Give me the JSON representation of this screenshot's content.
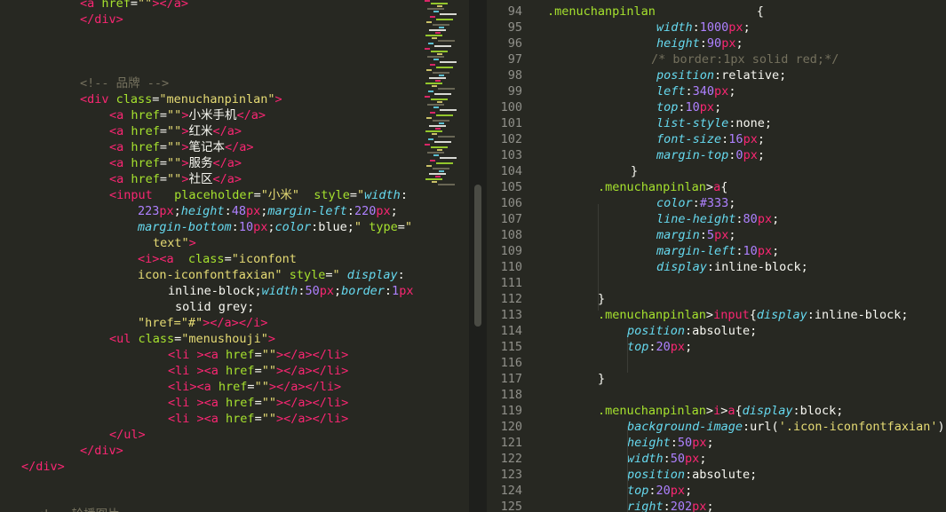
{
  "left_editor": {
    "lines": [
      [
        [
          "tag",
          "<a "
        ],
        [
          "attr",
          "href"
        ],
        [
          "plain",
          "="
        ],
        [
          "str",
          "\"\""
        ],
        [
          "tag",
          ">"
        ],
        [
          "tag",
          "</a>"
        ]
      ],
      [
        [
          "tag",
          "</div>"
        ]
      ],
      [],
      [],
      [],
      [
        [
          "cmt",
          "<!-- 品牌 -->"
        ]
      ],
      [
        [
          "tag",
          "<div "
        ],
        [
          "attr",
          "class"
        ],
        [
          "plain",
          "="
        ],
        [
          "str",
          "\"menuchanpinlan\""
        ],
        [
          "tag",
          ">"
        ]
      ],
      [
        [
          "tag",
          "<a "
        ],
        [
          "attr",
          "href"
        ],
        [
          "plain",
          "="
        ],
        [
          "str",
          "\"\""
        ],
        [
          "tag",
          ">"
        ],
        [
          "plain",
          "小米手机"
        ],
        [
          "tag",
          "</a>"
        ]
      ],
      [
        [
          "tag",
          "<a "
        ],
        [
          "attr",
          "href"
        ],
        [
          "plain",
          "="
        ],
        [
          "str",
          "\"\""
        ],
        [
          "tag",
          ">"
        ],
        [
          "plain",
          "红米"
        ],
        [
          "tag",
          "</a>"
        ]
      ],
      [
        [
          "tag",
          "<a "
        ],
        [
          "attr",
          "href"
        ],
        [
          "plain",
          "="
        ],
        [
          "str",
          "\"\""
        ],
        [
          "tag",
          ">"
        ],
        [
          "plain",
          "笔记本"
        ],
        [
          "tag",
          "</a>"
        ]
      ],
      [
        [
          "tag",
          "<a "
        ],
        [
          "attr",
          "href"
        ],
        [
          "plain",
          "="
        ],
        [
          "str",
          "\"\""
        ],
        [
          "tag",
          ">"
        ],
        [
          "plain",
          "服务"
        ],
        [
          "tag",
          "</a>"
        ]
      ],
      [
        [
          "tag",
          "<a "
        ],
        [
          "attr",
          "href"
        ],
        [
          "plain",
          "="
        ],
        [
          "str",
          "\"\""
        ],
        [
          "tag",
          ">"
        ],
        [
          "plain",
          "社区"
        ],
        [
          "tag",
          "</a>"
        ]
      ],
      [
        [
          "tag",
          "<input"
        ],
        [
          "plain",
          "   "
        ],
        [
          "attr",
          "placeholder"
        ],
        [
          "plain",
          "="
        ],
        [
          "str",
          "\"小米\""
        ],
        [
          "plain",
          "  "
        ],
        [
          "attr",
          "style"
        ],
        [
          "plain",
          "="
        ],
        [
          "str",
          "\""
        ],
        [
          "prop",
          "width"
        ],
        [
          "plain",
          ":"
        ]
      ],
      [
        [
          "num",
          "223"
        ],
        [
          "unit",
          "px"
        ],
        [
          "plain",
          ";"
        ],
        [
          "prop",
          "height"
        ],
        [
          "plain",
          ":"
        ],
        [
          "num",
          "48"
        ],
        [
          "unit",
          "px"
        ],
        [
          "plain",
          ";"
        ],
        [
          "prop",
          "margin-left"
        ],
        [
          "plain",
          ":"
        ],
        [
          "num",
          "220"
        ],
        [
          "unit",
          "px"
        ],
        [
          "plain",
          ";"
        ]
      ],
      [
        [
          "prop",
          "margin-bottom"
        ],
        [
          "plain",
          ":"
        ],
        [
          "num",
          "10"
        ],
        [
          "unit",
          "px"
        ],
        [
          "plain",
          ";"
        ],
        [
          "prop",
          "color"
        ],
        [
          "plain",
          ":blue;"
        ],
        [
          "str",
          "\""
        ],
        [
          "plain",
          " "
        ],
        [
          "attr",
          "type"
        ],
        [
          "plain",
          "="
        ],
        [
          "str",
          "\""
        ]
      ],
      [
        [
          "str",
          "text\""
        ],
        [
          "tag",
          ">"
        ]
      ],
      [
        [
          "tag",
          "<i>"
        ],
        [
          "tag",
          "<a"
        ],
        [
          "plain",
          "  "
        ],
        [
          "attr",
          "class"
        ],
        [
          "plain",
          "="
        ],
        [
          "str",
          "\"iconfont"
        ]
      ],
      [
        [
          "str",
          "icon-iconfontfaxian\""
        ],
        [
          "plain",
          " "
        ],
        [
          "attr",
          "style"
        ],
        [
          "plain",
          "="
        ],
        [
          "str",
          "\""
        ],
        [
          "plain",
          " "
        ],
        [
          "prop",
          "display"
        ],
        [
          "plain",
          ":"
        ]
      ],
      [
        [
          "plain",
          "inline-block;"
        ],
        [
          "prop",
          "width"
        ],
        [
          "plain",
          ":"
        ],
        [
          "num",
          "50"
        ],
        [
          "unit",
          "px"
        ],
        [
          "plain",
          ";"
        ],
        [
          "prop",
          "border"
        ],
        [
          "plain",
          ":"
        ],
        [
          "num",
          "1"
        ],
        [
          "unit",
          "px"
        ]
      ],
      [
        [
          "plain",
          "solid grey;"
        ]
      ],
      [
        [
          "str",
          "\"href=\"#\""
        ],
        [
          "tag",
          ">"
        ],
        [
          "tag",
          "</a>"
        ],
        [
          "tag",
          "</i>"
        ]
      ],
      [
        [
          "tag",
          "<ul "
        ],
        [
          "attr",
          "class"
        ],
        [
          "plain",
          "="
        ],
        [
          "str",
          "\"menushouji\""
        ],
        [
          "tag",
          ">"
        ]
      ],
      [
        [
          "tag",
          "<li "
        ],
        [
          "tag",
          ">"
        ],
        [
          "tag",
          "<a "
        ],
        [
          "attr",
          "href"
        ],
        [
          "plain",
          "="
        ],
        [
          "str",
          "\"\""
        ],
        [
          "tag",
          ">"
        ],
        [
          "tag",
          "</a>"
        ],
        [
          "tag",
          "</li>"
        ]
      ],
      [
        [
          "tag",
          "<li "
        ],
        [
          "tag",
          ">"
        ],
        [
          "tag",
          "<a "
        ],
        [
          "attr",
          "href"
        ],
        [
          "plain",
          "="
        ],
        [
          "str",
          "\"\""
        ],
        [
          "tag",
          ">"
        ],
        [
          "tag",
          "</a>"
        ],
        [
          "tag",
          "</li>"
        ]
      ],
      [
        [
          "tag",
          "<li>"
        ],
        [
          "tag",
          "<a "
        ],
        [
          "attr",
          "href"
        ],
        [
          "plain",
          "="
        ],
        [
          "str",
          "\"\""
        ],
        [
          "tag",
          ">"
        ],
        [
          "tag",
          "</a>"
        ],
        [
          "tag",
          "</li>"
        ]
      ],
      [
        [
          "tag",
          "<li "
        ],
        [
          "tag",
          ">"
        ],
        [
          "tag",
          "<a "
        ],
        [
          "attr",
          "href"
        ],
        [
          "plain",
          "="
        ],
        [
          "str",
          "\"\""
        ],
        [
          "tag",
          ">"
        ],
        [
          "tag",
          "</a>"
        ],
        [
          "tag",
          "</li>"
        ]
      ],
      [
        [
          "tag",
          "<li "
        ],
        [
          "tag",
          ">"
        ],
        [
          "tag",
          "<a "
        ],
        [
          "attr",
          "href"
        ],
        [
          "plain",
          "="
        ],
        [
          "str",
          "\"\""
        ],
        [
          "tag",
          ">"
        ],
        [
          "tag",
          "</a>"
        ],
        [
          "tag",
          "</li>"
        ]
      ],
      [
        [
          "tag",
          "</ul>"
        ]
      ],
      [
        [
          "tag",
          "</div>"
        ]
      ],
      [
        [
          "tag",
          "</div>"
        ]
      ],
      [],
      [],
      [
        [
          "cmt",
          "<!-- 轮播图片"
        ]
      ]
    ]
  },
  "right_editor": {
    "line_numbers": [
      "94",
      "95",
      "96",
      "97",
      "98",
      "99",
      "100",
      "101",
      "102",
      "103",
      "104",
      "105",
      "106",
      "107",
      "108",
      "109",
      "110",
      "111",
      "112",
      "113",
      "114",
      "115",
      "116",
      "117",
      "118",
      "119",
      "120",
      "121",
      "122",
      "123",
      "124",
      "125"
    ],
    "lines": [
      [
        [
          "sel",
          ".menuchanpinlan"
        ],
        [
          "plain",
          "              {"
        ]
      ],
      [
        [
          "prop",
          "width"
        ],
        [
          "plain",
          ":"
        ],
        [
          "num",
          "1000"
        ],
        [
          "unit",
          "px"
        ],
        [
          "plain",
          ";"
        ]
      ],
      [
        [
          "prop",
          "height"
        ],
        [
          "plain",
          ":"
        ],
        [
          "num",
          "90"
        ],
        [
          "unit",
          "px"
        ],
        [
          "plain",
          ";"
        ]
      ],
      [
        [
          "cmt",
          "/* border:1px solid red;*/"
        ]
      ],
      [
        [
          "prop",
          "position"
        ],
        [
          "plain",
          ":relative;"
        ]
      ],
      [
        [
          "prop",
          "left"
        ],
        [
          "plain",
          ":"
        ],
        [
          "num",
          "340"
        ],
        [
          "unit",
          "px"
        ],
        [
          "plain",
          ";"
        ]
      ],
      [
        [
          "prop",
          "top"
        ],
        [
          "plain",
          ":"
        ],
        [
          "num",
          "10"
        ],
        [
          "unit",
          "px"
        ],
        [
          "plain",
          ";"
        ]
      ],
      [
        [
          "prop",
          "list-style"
        ],
        [
          "plain",
          ":none;"
        ]
      ],
      [
        [
          "prop",
          "font-size"
        ],
        [
          "plain",
          ":"
        ],
        [
          "num",
          "16"
        ],
        [
          "unit",
          "px"
        ],
        [
          "plain",
          ";"
        ]
      ],
      [
        [
          "prop",
          "margin-top"
        ],
        [
          "plain",
          ":"
        ],
        [
          "num",
          "0"
        ],
        [
          "unit",
          "px"
        ],
        [
          "plain",
          ";"
        ]
      ],
      [
        [
          "plain",
          "}"
        ]
      ],
      [
        [
          "sel",
          ".menuchanpinlan"
        ],
        [
          "plain",
          ">"
        ],
        [
          "tag",
          "a"
        ],
        [
          "plain",
          "{"
        ]
      ],
      [
        [
          "prop",
          "color"
        ],
        [
          "plain",
          ":"
        ],
        [
          "num",
          "#333"
        ],
        [
          "plain",
          ";"
        ]
      ],
      [
        [
          "prop",
          "line-height"
        ],
        [
          "plain",
          ":"
        ],
        [
          "num",
          "80"
        ],
        [
          "unit",
          "px"
        ],
        [
          "plain",
          ";"
        ]
      ],
      [
        [
          "prop",
          "margin"
        ],
        [
          "plain",
          ":"
        ],
        [
          "num",
          "5"
        ],
        [
          "unit",
          "px"
        ],
        [
          "plain",
          ";"
        ]
      ],
      [
        [
          "prop",
          "margin-left"
        ],
        [
          "plain",
          ":"
        ],
        [
          "num",
          "10"
        ],
        [
          "unit",
          "px"
        ],
        [
          "plain",
          ";"
        ]
      ],
      [
        [
          "prop",
          "display"
        ],
        [
          "plain",
          ":inline-block;"
        ]
      ],
      [],
      [
        [
          "plain",
          "}"
        ]
      ],
      [
        [
          "sel",
          ".menuchanpinlan"
        ],
        [
          "plain",
          ">"
        ],
        [
          "tag",
          "input"
        ],
        [
          "plain",
          "{"
        ],
        [
          "prop",
          "display"
        ],
        [
          "plain",
          ":inline-block;"
        ]
      ],
      [
        [
          "prop",
          "position"
        ],
        [
          "plain",
          ":absolute;"
        ]
      ],
      [
        [
          "prop",
          "top"
        ],
        [
          "plain",
          ":"
        ],
        [
          "num",
          "20"
        ],
        [
          "unit",
          "px"
        ],
        [
          "plain",
          ";"
        ]
      ],
      [],
      [
        [
          "plain",
          "}"
        ]
      ],
      [],
      [
        [
          "sel",
          ".menuchanpinlan"
        ],
        [
          "plain",
          ">"
        ],
        [
          "tag",
          "i"
        ],
        [
          "plain",
          ">"
        ],
        [
          "tag",
          "a"
        ],
        [
          "plain",
          "{"
        ],
        [
          "prop",
          "display"
        ],
        [
          "plain",
          ":block;"
        ]
      ],
      [
        [
          "prop",
          "background-image"
        ],
        [
          "plain",
          ":url("
        ],
        [
          "str",
          "'.icon-iconfontfaxian'"
        ],
        [
          "plain",
          ")"
        ]
      ],
      [
        [
          "prop",
          "height"
        ],
        [
          "plain",
          ":"
        ],
        [
          "num",
          "50"
        ],
        [
          "unit",
          "px"
        ],
        [
          "plain",
          ";"
        ]
      ],
      [
        [
          "prop",
          "width"
        ],
        [
          "plain",
          ":"
        ],
        [
          "num",
          "50"
        ],
        [
          "unit",
          "px"
        ],
        [
          "plain",
          ";"
        ]
      ],
      [
        [
          "prop",
          "position"
        ],
        [
          "plain",
          ":absolute;"
        ]
      ],
      [
        [
          "prop",
          "top"
        ],
        [
          "plain",
          ":"
        ],
        [
          "num",
          "20"
        ],
        [
          "unit",
          "px"
        ],
        [
          "plain",
          ";"
        ]
      ],
      [
        [
          "prop",
          "right"
        ],
        [
          "plain",
          ":"
        ],
        [
          "num",
          "202"
        ],
        [
          "unit",
          "px"
        ],
        [
          "plain",
          ";"
        ]
      ]
    ]
  }
}
